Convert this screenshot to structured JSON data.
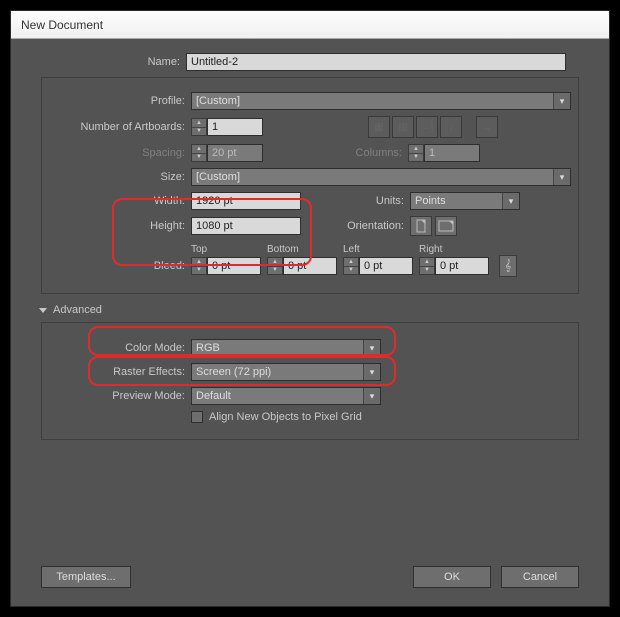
{
  "title": "New Document",
  "name": {
    "label": "Name:",
    "value": "Untitled-2"
  },
  "profile": {
    "label": "Profile:",
    "value": "[Custom]"
  },
  "artboards": {
    "label": "Number of Artboards:",
    "value": "1"
  },
  "spacing": {
    "label": "Spacing:",
    "value": "20 pt"
  },
  "columns": {
    "label": "Columns:",
    "value": "1"
  },
  "size": {
    "label": "Size:",
    "value": "[Custom]"
  },
  "width": {
    "label": "Width:",
    "value": "1920 pt"
  },
  "height": {
    "label": "Height:",
    "value": "1080 pt"
  },
  "units": {
    "label": "Units:",
    "value": "Points"
  },
  "orientation_label": "Orientation:",
  "bleed": {
    "label": "Bleed:",
    "top": {
      "label": "Top",
      "value": "0 pt"
    },
    "bottom": {
      "label": "Bottom",
      "value": "0 pt"
    },
    "left": {
      "label": "Left",
      "value": "0 pt"
    },
    "right": {
      "label": "Right",
      "value": "0 pt"
    }
  },
  "advanced": {
    "label": "Advanced"
  },
  "color_mode": {
    "label": "Color Mode:",
    "value": "RGB"
  },
  "raster": {
    "label": "Raster Effects:",
    "value": "Screen (72 ppi)"
  },
  "preview": {
    "label": "Preview Mode:",
    "value": "Default"
  },
  "align_grid": "Align New Objects to Pixel Grid",
  "buttons": {
    "templates": "Templates...",
    "ok": "OK",
    "cancel": "Cancel"
  }
}
